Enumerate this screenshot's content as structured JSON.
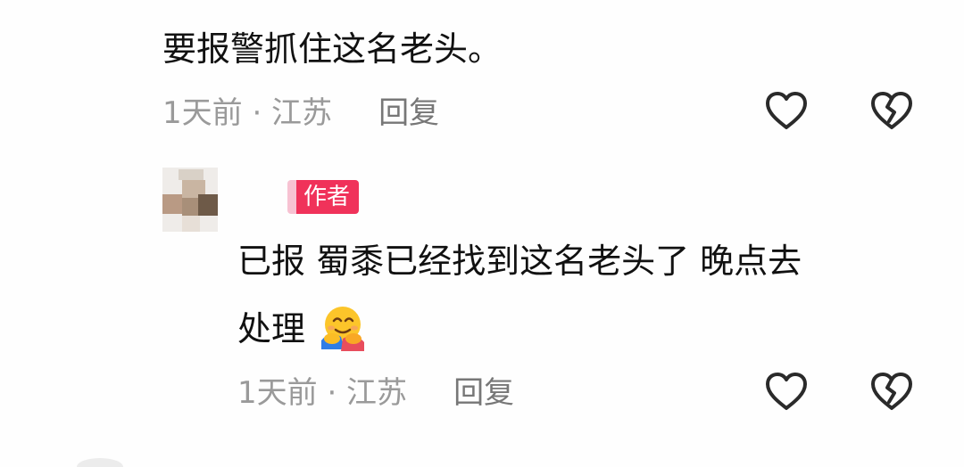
{
  "comment1": {
    "text": "要报警抓住这名老头。",
    "time_location": "1天前 · 江苏",
    "reply_label": "回复"
  },
  "reply1": {
    "author_badge": "作者",
    "text_line1": "已报 蜀黍已经找到这名老头了 晚点去",
    "text_line2": "处理",
    "emoji": "hugging-face-emoji",
    "time_location": "1天前 · 江苏",
    "reply_label": "回复"
  },
  "icons": {
    "like": "heart-outline-icon",
    "dislike": "broken-heart-icon"
  },
  "colors": {
    "badge": "#f0325a",
    "meta_text": "#9a9a9a",
    "body_text": "#111111"
  }
}
